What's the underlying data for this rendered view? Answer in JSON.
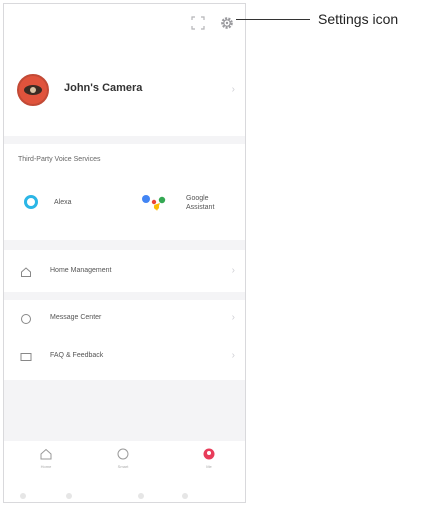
{
  "profile": {
    "name": "John's Camera"
  },
  "voice": {
    "title": "Third-Party Voice Services",
    "alexa_label": "Alexa",
    "google_label": "Google Assistant"
  },
  "menu": {
    "home_management": "Home Management",
    "message_center": "Message Center",
    "faq_feedback": "FAQ & Feedback"
  },
  "tabs": [
    {
      "label": "Home",
      "icon": "home-icon"
    },
    {
      "label": "Smart",
      "icon": "smart-icon"
    },
    {
      "label": "Me",
      "icon": "me-icon",
      "active": true
    }
  ],
  "callout": {
    "text": "Settings icon"
  },
  "colors": {
    "accent": "#e83c5a",
    "alexa": "#2bb6e6"
  }
}
